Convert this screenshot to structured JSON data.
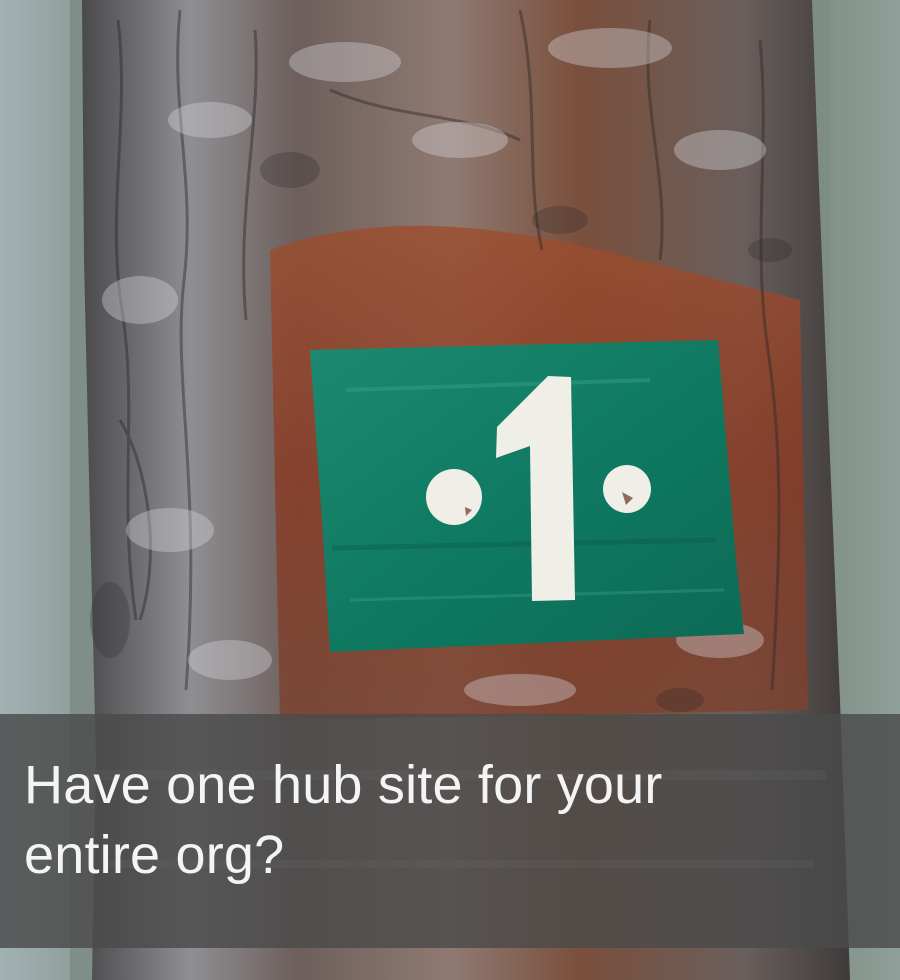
{
  "photo": {
    "marker_number": "1"
  },
  "caption": {
    "line1": "Have one hub site for your",
    "line2": "entire org?"
  },
  "colors": {
    "marker_green": "#0f7a61",
    "caption_band": "#4a4a4a",
    "caption_text": "#f4f4f4"
  }
}
